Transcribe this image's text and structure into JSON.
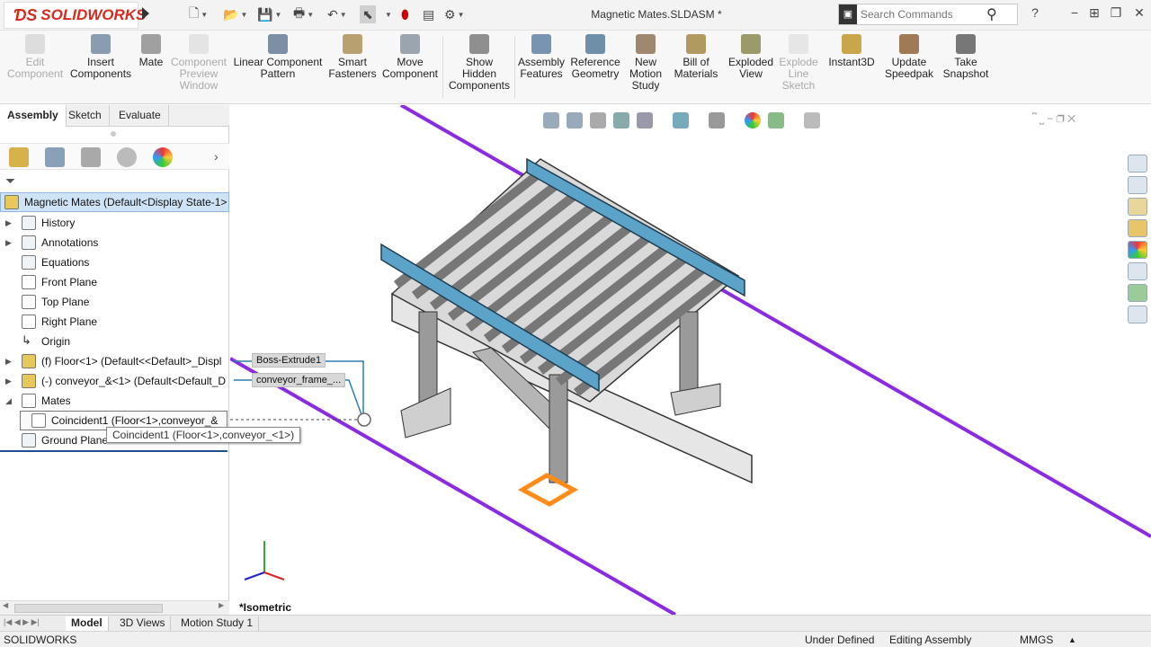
{
  "app": {
    "name": "SOLIDWORKS",
    "doc_title": "Magnetic Mates.SLDASM *"
  },
  "search": {
    "placeholder": "Search Commands"
  },
  "ribbon": [
    {
      "label": "Edit Component",
      "enabled": false
    },
    {
      "label": "Insert Components",
      "enabled": true
    },
    {
      "label": "Mate",
      "enabled": true
    },
    {
      "label": "Component Preview Window",
      "enabled": false
    },
    {
      "label": "Linear Component Pattern",
      "enabled": true
    },
    {
      "label": "Smart Fasteners",
      "enabled": true
    },
    {
      "label": "Move Component",
      "enabled": true
    },
    {
      "label": "Show Hidden Components",
      "enabled": true
    },
    {
      "label": "Assembly Features",
      "enabled": true
    },
    {
      "label": "Reference Geometry",
      "enabled": true
    },
    {
      "label": "New Motion Study",
      "enabled": true
    },
    {
      "label": "Bill of Materials",
      "enabled": true
    },
    {
      "label": "Exploded View",
      "enabled": true
    },
    {
      "label": "Explode Line Sketch",
      "enabled": false
    },
    {
      "label": "Instant3D",
      "enabled": true
    },
    {
      "label": "Update Speedpak",
      "enabled": true
    },
    {
      "label": "Take Snapshot",
      "enabled": true
    }
  ],
  "tabs": [
    "Assembly",
    "Sketch",
    "Evaluate"
  ],
  "tree": {
    "root": "Magnetic Mates  (Default<Display State-1>",
    "items": [
      {
        "label": "History",
        "expandable": true
      },
      {
        "label": "Annotations",
        "expandable": true
      },
      {
        "label": "Equations",
        "expandable": false
      },
      {
        "label": "Front Plane",
        "expandable": false
      },
      {
        "label": "Top Plane",
        "expandable": false
      },
      {
        "label": "Right Plane",
        "expandable": false
      },
      {
        "label": "Origin",
        "expandable": false
      },
      {
        "label": "(f) Floor<1> (Default<<Default>_Displ",
        "expandable": true
      },
      {
        "label": "(-) conveyor_&<1> (Default<Default_D",
        "expandable": true
      },
      {
        "label": "Mates",
        "expandable": true
      },
      {
        "label": "Coincident1 (Floor<1>,conveyor_&",
        "expandable": false
      },
      {
        "label": "Ground Plane",
        "expandable": false
      }
    ]
  },
  "callouts": {
    "boss": "Boss-Extrude1",
    "frame": "conveyor_frame_..."
  },
  "tooltip": "Coincident1 (Floor<1>,conveyor_<1>)",
  "viewport": {
    "view_label": "*Isometric"
  },
  "bottom_tabs": [
    "Model",
    "3D Views",
    "Motion Study 1"
  ],
  "status": {
    "app": "SOLIDWORKS",
    "state": "Under Defined",
    "mode": "Editing Assembly",
    "units": "MMGS"
  },
  "colors": {
    "mate_line": "#8a2be2",
    "frame": "#5ba3c9",
    "highlight": "#ff8c1a"
  }
}
